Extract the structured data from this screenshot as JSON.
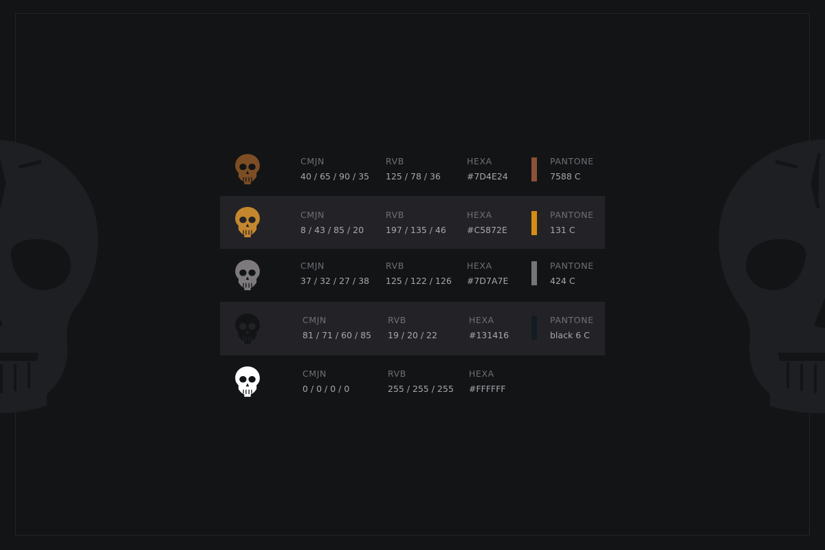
{
  "colors": {
    "background": "#131416",
    "row_alt": "#232327",
    "frame": "#232427",
    "label_text": "#6f7076",
    "value_text": "#a7a8ad",
    "decor_skull": "#1e1f22"
  },
  "decor": {
    "left_icon": "skull-icon",
    "right_icon": "skull-icon"
  },
  "palette": [
    {
      "icon": "skull-icon",
      "skull_color": "#7D4E24",
      "swatch_color": "#8b5237",
      "cmjn": {
        "label": "CMJN",
        "value": "40 / 65 / 90 / 35"
      },
      "rvb": {
        "label": "RVB",
        "value": "125 / 78 / 36"
      },
      "hexa": {
        "label": "HEXA",
        "value": "#7D4E24"
      },
      "pantone": {
        "label": "PANTONE",
        "value": "7588 C"
      }
    },
    {
      "icon": "skull-icon",
      "skull_color": "#C5872E",
      "swatch_color": "#d68d15",
      "cmjn": {
        "label": "CMJN",
        "value": "8 / 43 / 85 / 20"
      },
      "rvb": {
        "label": "RVB",
        "value": "197 / 135 / 46"
      },
      "hexa": {
        "label": "HEXA",
        "value": "#C5872E"
      },
      "pantone": {
        "label": "PANTONE",
        "value": "131 C"
      }
    },
    {
      "icon": "skull-icon",
      "skull_color": "#7D7A7E",
      "swatch_color": "#767678",
      "cmjn": {
        "label": "CMJN",
        "value": "37 / 32 / 27 / 38"
      },
      "rvb": {
        "label": "RVB",
        "value": "125 / 122 / 126"
      },
      "hexa": {
        "label": "HEXA",
        "value": "#7D7A7E"
      },
      "pantone": {
        "label": "PANTONE",
        "value": "424 C"
      }
    },
    {
      "icon": "skull-icon",
      "skull_color": "#131416",
      "swatch_color": "#141b22",
      "cmjn": {
        "label": "CMJN",
        "value": "81 / 71 / 60 / 85"
      },
      "rvb": {
        "label": "RVB",
        "value": "19 / 20 / 22"
      },
      "hexa": {
        "label": "HEXA",
        "value": "#131416"
      },
      "pantone": {
        "label": "PANTONE",
        "value": "black 6 C"
      }
    },
    {
      "icon": "skull-icon",
      "skull_color": "#FFFFFF",
      "cmjn": {
        "label": "CMJN",
        "value": "0 / 0 / 0 / 0"
      },
      "rvb": {
        "label": "RVB",
        "value": "255 / 255 / 255"
      },
      "hexa": {
        "label": "HEXA",
        "value": "#FFFFFF"
      }
    }
  ]
}
